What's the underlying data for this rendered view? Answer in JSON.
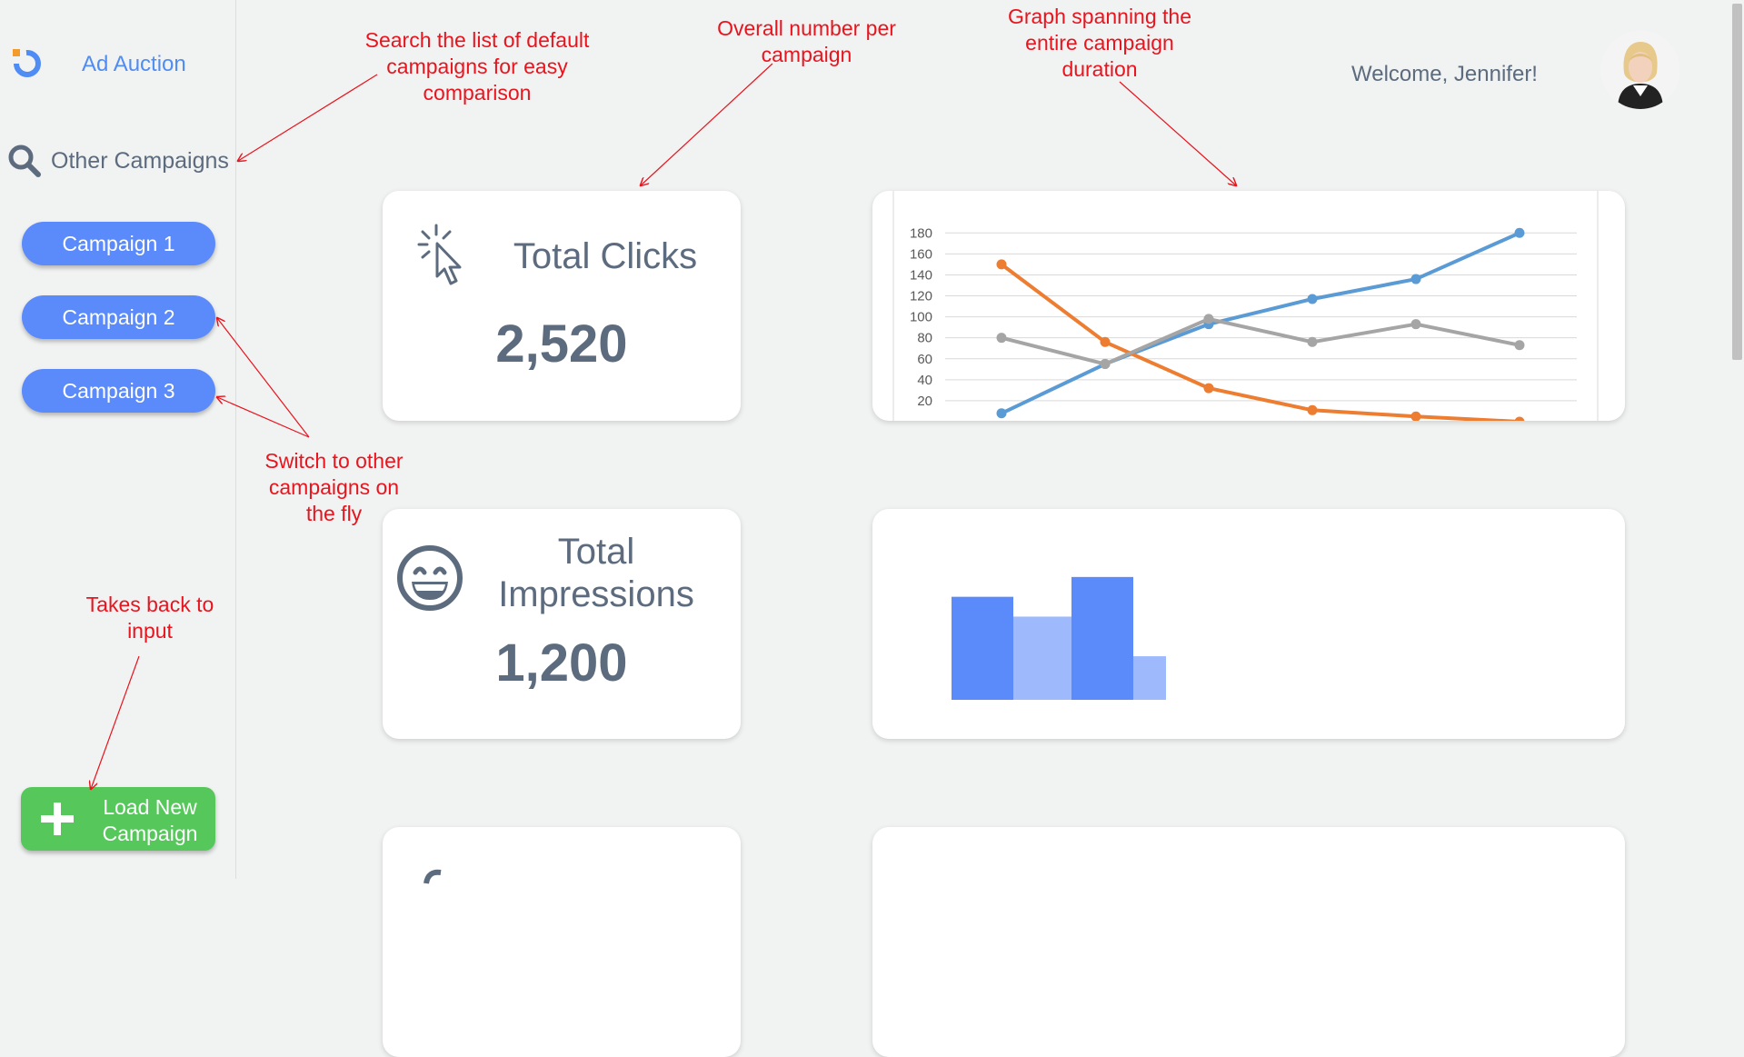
{
  "app": {
    "title": "Ad Auction"
  },
  "sidebar": {
    "search_label": "Other Campaigns",
    "campaigns": [
      {
        "label": "Campaign 1"
      },
      {
        "label": "Campaign 2"
      },
      {
        "label": "Campaign 3"
      }
    ],
    "load_button": {
      "label": "Load New Campaign"
    }
  },
  "header": {
    "welcome": "Welcome, Jennifer!"
  },
  "cards": {
    "clicks": {
      "title": "Total Clicks",
      "value": "2,520"
    },
    "impressions": {
      "title": "Total Impressions",
      "value": "1,200"
    }
  },
  "annotations": {
    "search": "Search the list of default campaigns for easy comparison",
    "overall": "Overall number per campaign",
    "graph": "Graph spanning the entire campaign duration",
    "switch": "Switch to other campaigns on the fly",
    "takes_back": "Takes back to input"
  },
  "colors": {
    "accent": "#5b8bfb",
    "load": "#56c85b",
    "text": "#5c6b7e",
    "annotation": "#e8141e",
    "series_blue": "#5b9bd5",
    "series_orange": "#ed7d31",
    "series_gray": "#a5a5a5"
  },
  "chart_data": [
    {
      "type": "line",
      "x": [
        1,
        2,
        3,
        4,
        5,
        6
      ],
      "series": [
        {
          "values": [
            8,
            55,
            93,
            117,
            136,
            180
          ]
        },
        {
          "values": [
            150,
            76,
            32,
            11,
            5,
            0
          ]
        },
        {
          "values": [
            80,
            55,
            98,
            76,
            93,
            73
          ]
        }
      ],
      "ylim": [
        0,
        180
      ],
      "yticks": [
        "180",
        "160",
        "140",
        "120",
        "100",
        "80",
        "60",
        "40",
        "20"
      ],
      "grid": true
    },
    {
      "type": "bar",
      "categories": [
        "1",
        "2",
        "3",
        "4"
      ],
      "values": [
        52,
        42,
        62,
        22
      ]
    }
  ]
}
